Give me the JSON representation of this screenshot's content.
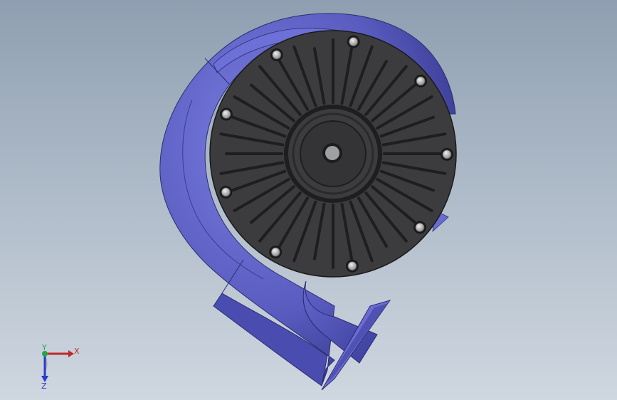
{
  "viewport": {
    "background_top": "#8f9fb1",
    "background_bottom": "#cfd7e0"
  },
  "model": {
    "housing_color": "#5a5cc0",
    "housing_shadow": "#3b3c95",
    "cover_color": "#3a3a3c",
    "fin_color": "#1e1e20",
    "bolt_color": "#c9c9c9",
    "bolt_count": 9,
    "fin_count": 36
  },
  "triad": {
    "x_label": "X",
    "y_label": "Y",
    "z_label": "Z",
    "x_color": "#c0282a",
    "y_color": "#27a34a",
    "z_color": "#2a3cc8"
  }
}
